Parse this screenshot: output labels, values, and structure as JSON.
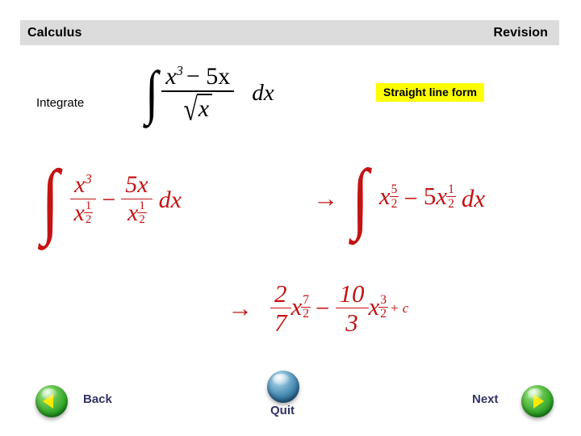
{
  "header": {
    "title_left": "Calculus",
    "title_right": "Revision",
    "background": "#dcdcdc"
  },
  "content": {
    "integrate_label": "Integrate",
    "badge": {
      "text": "Straight line form",
      "background": "#ffff00",
      "color": "#000000"
    },
    "math_color": "#c41313",
    "expressions": {
      "original": {
        "plain": "∫ (x^3 − 5x) / √x  dx",
        "integral_glyph": "∫",
        "numerator_base": "x",
        "numerator_exponent": "3",
        "numerator_term": "− 5x",
        "denominator_radical": "√",
        "denominator_radicand": "x",
        "differential": "dx"
      },
      "step1": {
        "plain": "∫ x^3/x^(1/2) − 5x/x^(1/2) dx",
        "integral_glyph": "∫",
        "frac1_num_base": "x",
        "frac1_num_exp": "3",
        "frac1_den_base": "x",
        "frac1_den_exp_num": "1",
        "frac1_den_exp_den": "2",
        "operator": "−",
        "frac2_num": "5x",
        "frac2_den_base": "x",
        "frac2_den_exp_num": "1",
        "frac2_den_exp_den": "2",
        "differential": "dx"
      },
      "step2": {
        "plain": "→ ∫ x^(5/2) − 5x^(1/2) dx",
        "arrow": "→",
        "integral_glyph": "∫",
        "term1_base": "x",
        "term1_exp_num": "5",
        "term1_exp_den": "2",
        "operator": "−",
        "term2_coefficient": "5",
        "term2_base": "x",
        "term2_exp_num": "1",
        "term2_exp_den": "2",
        "differential": "dx"
      },
      "step3": {
        "plain": "→ (2/7)x^(7/2) − (10/3)x^(3/2) + c",
        "arrow": "→",
        "coef1_num": "2",
        "coef1_den": "7",
        "term1_base": "x",
        "term1_exp_num": "7",
        "term1_exp_den": "2",
        "operator": "−",
        "coef2_num": "10",
        "coef2_den": "3",
        "term2_base": "x",
        "term2_exp_num": "3",
        "term2_exp_den": "2",
        "constant": "+ c"
      }
    }
  },
  "navigation": {
    "back_label": "Back",
    "quit_label": "Quit",
    "next_label": "Next",
    "back_icon": "left-triangle-icon",
    "quit_icon": "blue-orb-icon",
    "next_icon": "right-triangle-icon",
    "text_color": "#333366"
  }
}
